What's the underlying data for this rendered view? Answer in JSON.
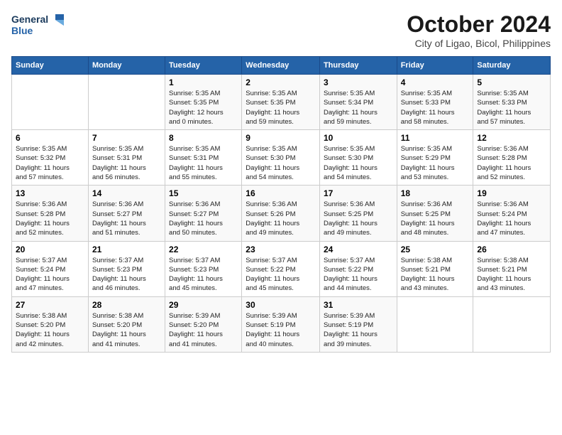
{
  "logo": {
    "line1": "General",
    "line2": "Blue"
  },
  "title": "October 2024",
  "subtitle": "City of Ligao, Bicol, Philippines",
  "weekdays": [
    "Sunday",
    "Monday",
    "Tuesday",
    "Wednesday",
    "Thursday",
    "Friday",
    "Saturday"
  ],
  "weeks": [
    [
      {
        "day": "",
        "text": ""
      },
      {
        "day": "",
        "text": ""
      },
      {
        "day": "1",
        "text": "Sunrise: 5:35 AM\nSunset: 5:35 PM\nDaylight: 12 hours\nand 0 minutes."
      },
      {
        "day": "2",
        "text": "Sunrise: 5:35 AM\nSunset: 5:35 PM\nDaylight: 11 hours\nand 59 minutes."
      },
      {
        "day": "3",
        "text": "Sunrise: 5:35 AM\nSunset: 5:34 PM\nDaylight: 11 hours\nand 59 minutes."
      },
      {
        "day": "4",
        "text": "Sunrise: 5:35 AM\nSunset: 5:33 PM\nDaylight: 11 hours\nand 58 minutes."
      },
      {
        "day": "5",
        "text": "Sunrise: 5:35 AM\nSunset: 5:33 PM\nDaylight: 11 hours\nand 57 minutes."
      }
    ],
    [
      {
        "day": "6",
        "text": "Sunrise: 5:35 AM\nSunset: 5:32 PM\nDaylight: 11 hours\nand 57 minutes."
      },
      {
        "day": "7",
        "text": "Sunrise: 5:35 AM\nSunset: 5:31 PM\nDaylight: 11 hours\nand 56 minutes."
      },
      {
        "day": "8",
        "text": "Sunrise: 5:35 AM\nSunset: 5:31 PM\nDaylight: 11 hours\nand 55 minutes."
      },
      {
        "day": "9",
        "text": "Sunrise: 5:35 AM\nSunset: 5:30 PM\nDaylight: 11 hours\nand 54 minutes."
      },
      {
        "day": "10",
        "text": "Sunrise: 5:35 AM\nSunset: 5:30 PM\nDaylight: 11 hours\nand 54 minutes."
      },
      {
        "day": "11",
        "text": "Sunrise: 5:35 AM\nSunset: 5:29 PM\nDaylight: 11 hours\nand 53 minutes."
      },
      {
        "day": "12",
        "text": "Sunrise: 5:36 AM\nSunset: 5:28 PM\nDaylight: 11 hours\nand 52 minutes."
      }
    ],
    [
      {
        "day": "13",
        "text": "Sunrise: 5:36 AM\nSunset: 5:28 PM\nDaylight: 11 hours\nand 52 minutes."
      },
      {
        "day": "14",
        "text": "Sunrise: 5:36 AM\nSunset: 5:27 PM\nDaylight: 11 hours\nand 51 minutes."
      },
      {
        "day": "15",
        "text": "Sunrise: 5:36 AM\nSunset: 5:27 PM\nDaylight: 11 hours\nand 50 minutes."
      },
      {
        "day": "16",
        "text": "Sunrise: 5:36 AM\nSunset: 5:26 PM\nDaylight: 11 hours\nand 49 minutes."
      },
      {
        "day": "17",
        "text": "Sunrise: 5:36 AM\nSunset: 5:25 PM\nDaylight: 11 hours\nand 49 minutes."
      },
      {
        "day": "18",
        "text": "Sunrise: 5:36 AM\nSunset: 5:25 PM\nDaylight: 11 hours\nand 48 minutes."
      },
      {
        "day": "19",
        "text": "Sunrise: 5:36 AM\nSunset: 5:24 PM\nDaylight: 11 hours\nand 47 minutes."
      }
    ],
    [
      {
        "day": "20",
        "text": "Sunrise: 5:37 AM\nSunset: 5:24 PM\nDaylight: 11 hours\nand 47 minutes."
      },
      {
        "day": "21",
        "text": "Sunrise: 5:37 AM\nSunset: 5:23 PM\nDaylight: 11 hours\nand 46 minutes."
      },
      {
        "day": "22",
        "text": "Sunrise: 5:37 AM\nSunset: 5:23 PM\nDaylight: 11 hours\nand 45 minutes."
      },
      {
        "day": "23",
        "text": "Sunrise: 5:37 AM\nSunset: 5:22 PM\nDaylight: 11 hours\nand 45 minutes."
      },
      {
        "day": "24",
        "text": "Sunrise: 5:37 AM\nSunset: 5:22 PM\nDaylight: 11 hours\nand 44 minutes."
      },
      {
        "day": "25",
        "text": "Sunrise: 5:38 AM\nSunset: 5:21 PM\nDaylight: 11 hours\nand 43 minutes."
      },
      {
        "day": "26",
        "text": "Sunrise: 5:38 AM\nSunset: 5:21 PM\nDaylight: 11 hours\nand 43 minutes."
      }
    ],
    [
      {
        "day": "27",
        "text": "Sunrise: 5:38 AM\nSunset: 5:20 PM\nDaylight: 11 hours\nand 42 minutes."
      },
      {
        "day": "28",
        "text": "Sunrise: 5:38 AM\nSunset: 5:20 PM\nDaylight: 11 hours\nand 41 minutes."
      },
      {
        "day": "29",
        "text": "Sunrise: 5:39 AM\nSunset: 5:20 PM\nDaylight: 11 hours\nand 41 minutes."
      },
      {
        "day": "30",
        "text": "Sunrise: 5:39 AM\nSunset: 5:19 PM\nDaylight: 11 hours\nand 40 minutes."
      },
      {
        "day": "31",
        "text": "Sunrise: 5:39 AM\nSunset: 5:19 PM\nDaylight: 11 hours\nand 39 minutes."
      },
      {
        "day": "",
        "text": ""
      },
      {
        "day": "",
        "text": ""
      }
    ]
  ]
}
